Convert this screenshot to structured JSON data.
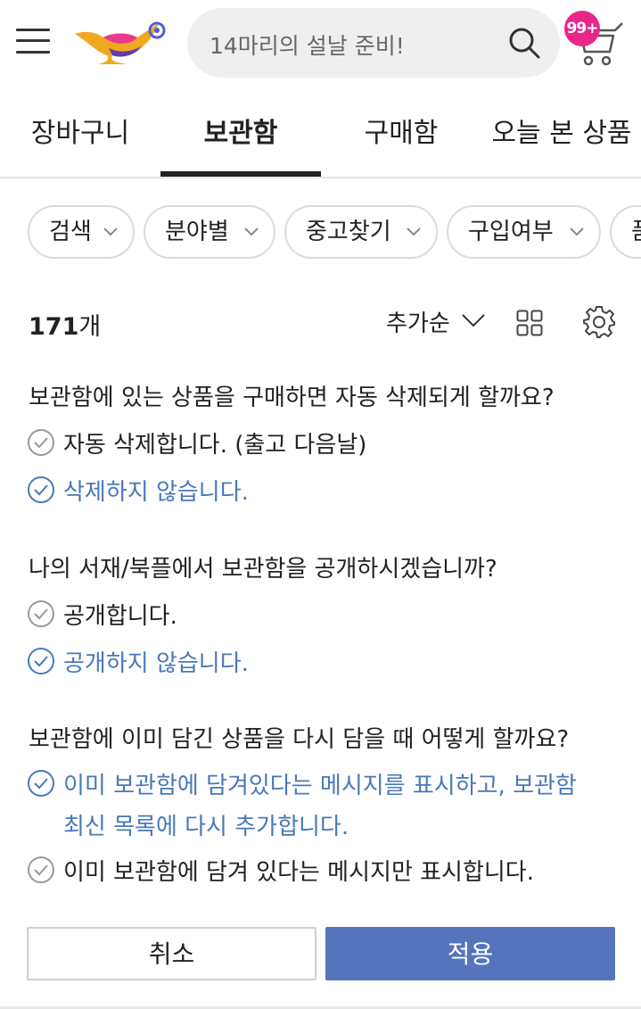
{
  "header": {
    "search_placeholder": "14마리의 설날 준비!",
    "cart_badge": "99+"
  },
  "tabs": [
    {
      "label": "장바구니",
      "active": false
    },
    {
      "label": "보관함",
      "active": true
    },
    {
      "label": "구매함",
      "active": false
    },
    {
      "label": "오늘 본 상품",
      "active": false
    }
  ],
  "filters": [
    {
      "label": "검색"
    },
    {
      "label": "분야별"
    },
    {
      "label": "중고찾기"
    },
    {
      "label": "구입여부"
    },
    {
      "label": "품"
    }
  ],
  "list": {
    "count": "171",
    "count_unit": "개",
    "sort_label": "추가순"
  },
  "settings": [
    {
      "question": "보관함에 있는 상품을 구매하면 자동 삭제되게 할까요?",
      "options": [
        {
          "label": "자동 삭제합니다. (출고 다음날)",
          "selected": false
        },
        {
          "label": "삭제하지 않습니다.",
          "selected": true
        }
      ]
    },
    {
      "question": "나의 서재/북플에서 보관함을 공개하시겠습니까?",
      "options": [
        {
          "label": "공개합니다.",
          "selected": false
        },
        {
          "label": "공개하지 않습니다.",
          "selected": true
        }
      ]
    },
    {
      "question": "보관함에 이미 담긴 상품을 다시 담을 때 어떻게 할까요?",
      "options": [
        {
          "label": "이미 보관함에 담겨있다는 메시지를 표시하고, 보관함",
          "label_line2": "최신 목록에 다시 추가합니다.",
          "selected": true
        },
        {
          "label": "이미 보관함에 담겨 있다는 메시지만 표시합니다.",
          "selected": false
        }
      ]
    }
  ],
  "buttons": {
    "cancel": "취소",
    "apply": "적용"
  },
  "colors": {
    "accent_blue": "#4a78b8",
    "apply_button": "#5574bb",
    "badge_pink": "#e8268a"
  }
}
